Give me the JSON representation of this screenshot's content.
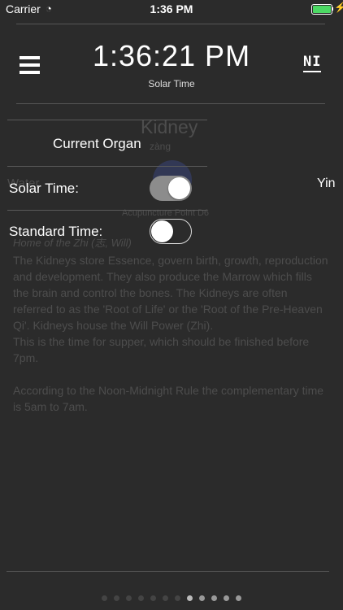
{
  "status_bar": {
    "carrier": "Carrier",
    "time": "1:36 PM"
  },
  "header": {
    "time": "1:36:21 PM",
    "caption": "Solar Time",
    "badge": "NI"
  },
  "organ": {
    "name": "Kidney",
    "pinyin": "zàng",
    "element": "Water",
    "yin_yang": "Yin",
    "point": "Acupuncture Point D6",
    "heading": "Home of the Zhi (志, Will)",
    "description": "The Kidneys store Essence, govern birth, growth, reproduction and development. They also produce the Marrow which fills the brain and control the bones. The Kidneys are often referred to as the 'Root of Life' or the 'Root of the Pre-Heaven Qi'. Kidneys house the Will Power (Zhi).",
    "supper": "This is the time for supper, which should be finished before 7pm.",
    "rule": "According to the Noon-Midnight Rule the complementary time is 5am to 7am.",
    "link": ""
  },
  "panel": {
    "title": "Current Organ",
    "solar_label": "Solar Time:",
    "solar_on": true,
    "standard_label": "Standard Time:",
    "standard_on": false
  },
  "pages": {
    "count": 12,
    "active": 7
  },
  "colors": {
    "toggle_on": "#8c8c8c",
    "toggle_off": "#2b2b2b",
    "battery": "#4cd964"
  }
}
